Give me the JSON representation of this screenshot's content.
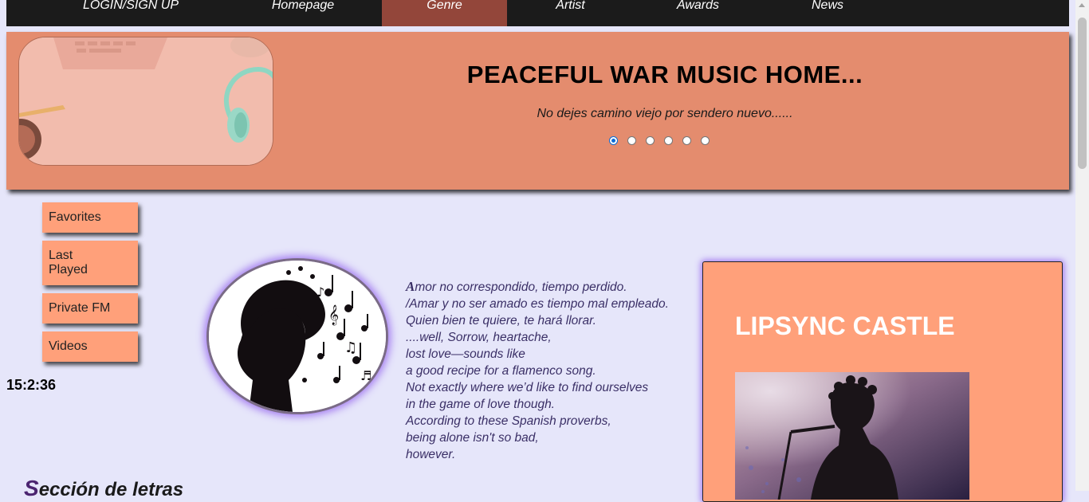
{
  "nav": {
    "items": [
      {
        "label": "LOGIN/SIGN UP"
      },
      {
        "label": "Homepage"
      },
      {
        "label": "Genre"
      },
      {
        "label": "Artist"
      },
      {
        "label": "Awards"
      },
      {
        "label": "News"
      }
    ],
    "active_index": 2,
    "active_color": "#93463a"
  },
  "hero": {
    "title": "PEACEFUL WAR MUSIC HOME...",
    "subtitle": "No dejes camino viejo por sendero nuevo......",
    "slide_count": 6,
    "selected_slide": 1,
    "background": "#e48c6e"
  },
  "sidebar": {
    "items": [
      {
        "label": "Favorites"
      },
      {
        "label": "Last Played"
      },
      {
        "label": "Private FM"
      },
      {
        "label": "Videos"
      }
    ]
  },
  "clock": "15:2:36",
  "poem": {
    "first_letter": "A",
    "first_line_rest": "mor no correspondido, tiempo perdido.",
    "lines": [
      "/Amar y no ser amado es tiempo mal empleado.",
      "Quien bien te quiere, te hará llorar.",
      "....well, Sorrow, heartache,",
      "lost love—sounds like",
      "a good recipe for a flamenco song.",
      "Not exactly where we’d like to find ourselves",
      "in the game of love though.",
      "According to these Spanish proverbs,",
      "being alone isn't so bad,",
      "however."
    ]
  },
  "section": {
    "cap": "S",
    "rest": "ección de letras"
  },
  "card": {
    "title": "LIPSYNC CASTLE",
    "background": "#ffa07a"
  }
}
